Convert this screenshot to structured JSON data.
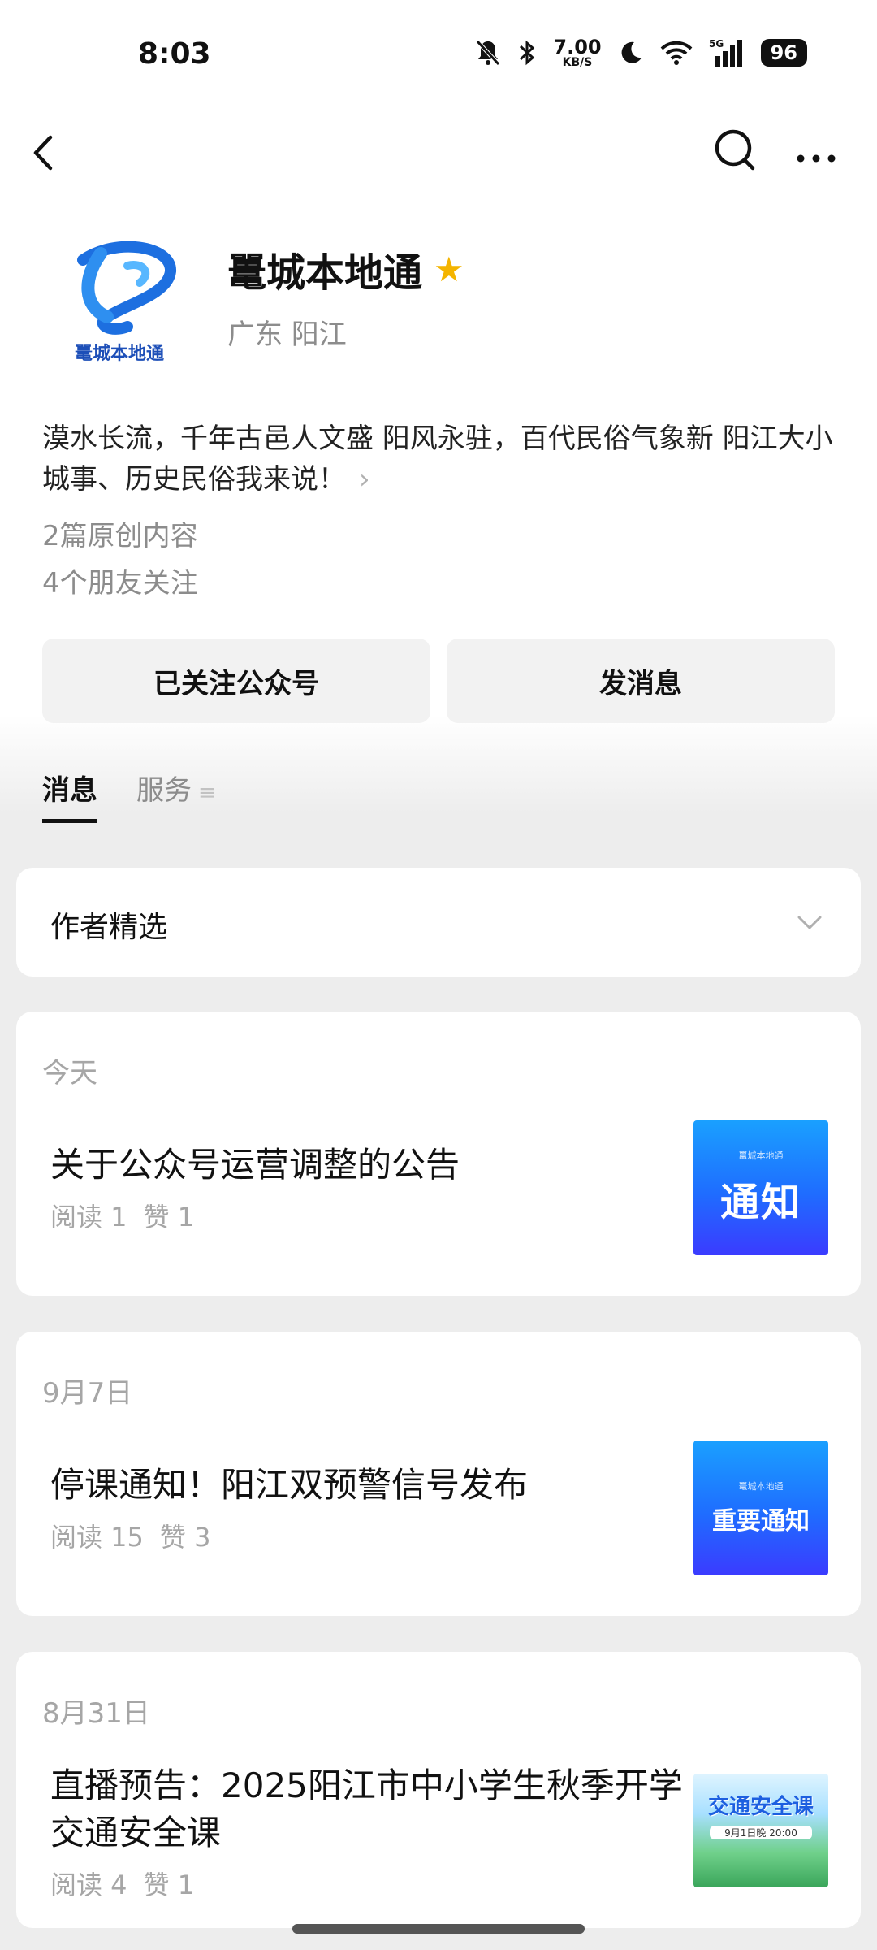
{
  "status_bar": {
    "time": "8:03",
    "net_speed_value": "7.00",
    "net_speed_unit": "KB/S",
    "network": "5G",
    "battery": "96"
  },
  "profile": {
    "name": "鼍城本地通",
    "region": "广东 阳江",
    "avatar_text": "鼍城本地通",
    "description": "漠水长流，千年古邑人文盛 阳风永驻，百代民俗气象新 阳江大小城事、历史民俗我来说！",
    "description_arrow": "›",
    "original_count": "2篇原创内容",
    "friends_following": "4个朋友关注"
  },
  "actions": {
    "followed_label": "已关注公众号",
    "message_label": "发消息"
  },
  "tabs": [
    {
      "label": "消息",
      "active": true
    },
    {
      "label": "服务",
      "active": false
    }
  ],
  "selection": {
    "label": "作者精选"
  },
  "articles": [
    {
      "date": "今天",
      "title": "关于公众号运营调整的公告",
      "reads": "阅读 1",
      "likes": "赞 1",
      "thumb_small": "鼍城本地通",
      "thumb_text": "通知"
    },
    {
      "date": "9月7日",
      "title": "停课通知！阳江双预警信号发布",
      "reads": "阅读 15",
      "likes": "赞 3",
      "thumb_small": "鼍城本地通",
      "thumb_text": "重要通知"
    },
    {
      "date": "8月31日",
      "title": "直播预告：2025阳江市中小学生秋季开学交通安全课",
      "reads": "阅读 4",
      "likes": "赞 1",
      "thumb_text": "交通安全课",
      "thumb_sub": "9月1日晚 20:00"
    }
  ],
  "colors": {
    "star": "#f4b400",
    "thumb_blue": "#1f6cff",
    "muted_text": "#a6a6a6"
  }
}
